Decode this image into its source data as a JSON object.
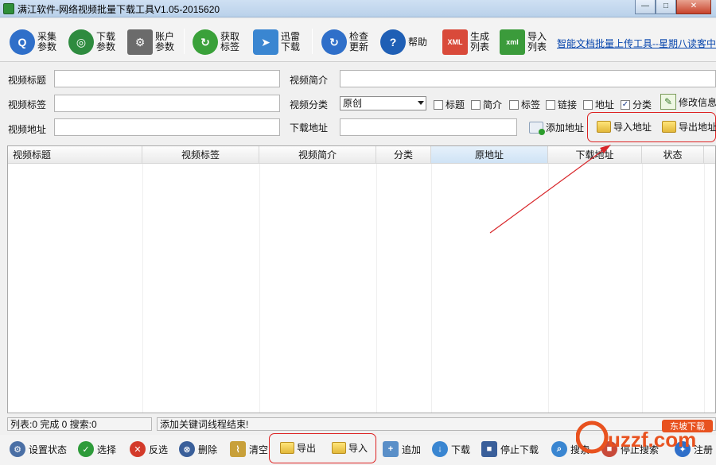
{
  "window": {
    "title": "满江软件-网络视频批量下载工具V1.05-2015620",
    "buttons": {
      "minimize": "—",
      "maximize": "□",
      "close": "✕"
    }
  },
  "toolbar": {
    "items": [
      {
        "label": "采集参数",
        "icon": "search-icon",
        "color": "#2f6fc9"
      },
      {
        "label": "下载参数",
        "icon": "globe-icon",
        "color": "#2e8b3f"
      },
      {
        "label": "账户参数",
        "icon": "disk-gear-icon",
        "color": "#6b6b6b"
      },
      {
        "label": "获取标签",
        "icon": "refresh-icon",
        "color": "#3aa13a"
      },
      {
        "label": "迅雷下载",
        "icon": "thunder-icon",
        "color": "#3a86d1"
      },
      {
        "label": "检查更新",
        "icon": "update-icon",
        "color": "#2f6fc9"
      },
      {
        "label": "帮助",
        "icon": "help-icon",
        "color": "#1f5fb5"
      },
      {
        "label": "生成列表",
        "icon": "xml-icon",
        "color": "#d94a3a"
      },
      {
        "label": "导入列表",
        "icon": "xml-import-icon",
        "color": "#3b9b3b"
      }
    ],
    "link": "智能文档批量上传工具--星期八读客中"
  },
  "form": {
    "title_label": "视频标题",
    "intro_label": "视频简介",
    "tags_label": "视频标签",
    "category_label": "视频分类",
    "category_value": "原创",
    "url_label": "视频地址",
    "download_label": "下载地址",
    "checkboxes": [
      {
        "label": "标题",
        "checked": false
      },
      {
        "label": "简介",
        "checked": false
      },
      {
        "label": "标签",
        "checked": false
      },
      {
        "label": "链接",
        "checked": false
      },
      {
        "label": "地址",
        "checked": false
      },
      {
        "label": "分类",
        "checked": true
      }
    ],
    "modify_label": "修改信息",
    "add_address_label": "添加地址",
    "import_address_label": "导入地址",
    "export_address_label": "导出地址"
  },
  "table": {
    "columns": [
      "视频标题",
      "视频标签",
      "视频简介",
      "分类",
      "原地址",
      "下载地址",
      "状态"
    ]
  },
  "status": {
    "counts": "列表:0 完成 0 搜索:0",
    "message": "添加关键词线程结束!"
  },
  "bottom": {
    "items": [
      {
        "label": "设置状态",
        "icon": "gear-icon",
        "color": "#4a6fa5"
      },
      {
        "label": "选择",
        "icon": "check-icon",
        "color": "#2e9b3a"
      },
      {
        "label": "反选",
        "icon": "cross-icon",
        "color": "#d33a2a"
      },
      {
        "label": "删除",
        "icon": "delete-icon",
        "color": "#3a5f9a"
      },
      {
        "label": "清空",
        "icon": "broom-icon",
        "color": "#c8a03a"
      },
      {
        "label": "导出",
        "icon": "folder-export-icon",
        "color": "#e2b83a"
      },
      {
        "label": "导入",
        "icon": "folder-import-icon",
        "color": "#e2b83a"
      },
      {
        "label": "追加",
        "icon": "append-icon",
        "color": "#5a8fc8"
      },
      {
        "label": "下载",
        "icon": "download-icon",
        "color": "#3a86d1"
      },
      {
        "label": "停止下载",
        "icon": "stop-icon",
        "color": "#3a5f9a"
      },
      {
        "label": "搜索",
        "icon": "search-icon",
        "color": "#3a86d1"
      },
      {
        "label": "停止搜索",
        "icon": "stop-search-icon",
        "color": "#c84a3a"
      },
      {
        "label": "注册",
        "icon": "register-icon",
        "color": "#2f6fc9"
      }
    ]
  },
  "watermark": {
    "text": "uzzf.com",
    "tag": "东坡下载"
  }
}
